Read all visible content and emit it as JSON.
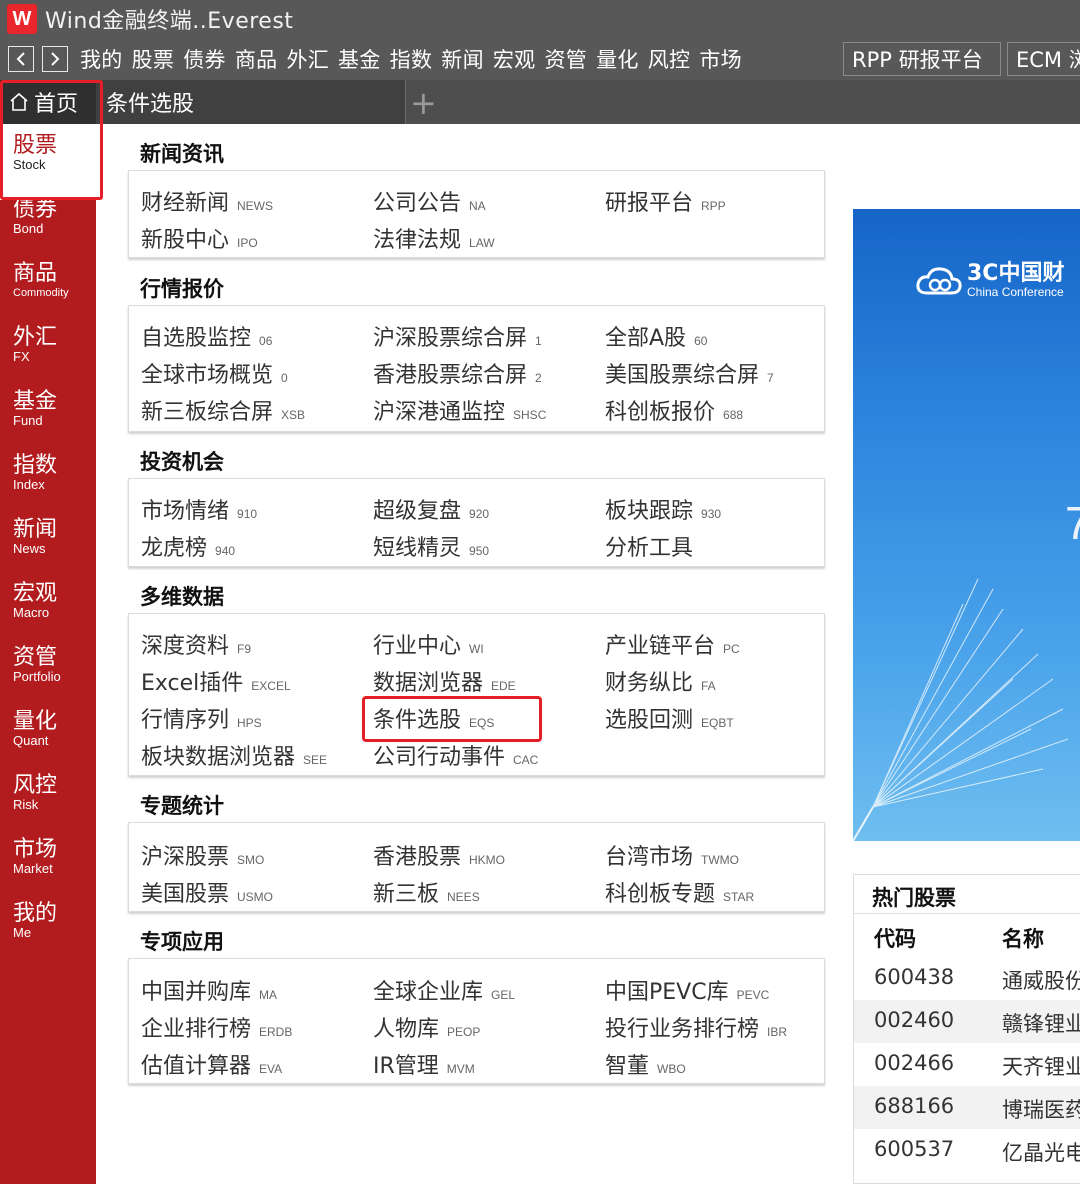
{
  "window": {
    "logo": "W",
    "title": "Wind金融终端..Everest"
  },
  "menubar": {
    "back_icon": "chevron-left-icon",
    "forward_icon": "chevron-right-icon",
    "items": [
      "我的",
      "股票",
      "债券",
      "商品",
      "外汇",
      "基金",
      "指数",
      "新闻",
      "宏观",
      "资管",
      "量化",
      "风控",
      "市场"
    ],
    "rpp_button": "RPP 研报平台",
    "ecm_button": "ECM 浏"
  },
  "tabs": {
    "home_icon": "home-icon",
    "home_label": "首页",
    "active_tab": "条件选股",
    "add_label": "+"
  },
  "sidebar": [
    {
      "zh": "股票",
      "en": "Stock"
    },
    {
      "zh": "债券",
      "en": "Bond"
    },
    {
      "zh": "商品",
      "en": "Commodity"
    },
    {
      "zh": "外汇",
      "en": "FX"
    },
    {
      "zh": "基金",
      "en": "Fund"
    },
    {
      "zh": "指数",
      "en": "Index"
    },
    {
      "zh": "新闻",
      "en": "News"
    },
    {
      "zh": "宏观",
      "en": "Macro"
    },
    {
      "zh": "资管",
      "en": "Portfolio"
    },
    {
      "zh": "量化",
      "en": "Quant"
    },
    {
      "zh": "风控",
      "en": "Risk"
    },
    {
      "zh": "市场",
      "en": "Market"
    },
    {
      "zh": "我的",
      "en": "Me"
    }
  ],
  "sections": [
    {
      "title": "新闻资讯",
      "items": [
        {
          "label": "财经新闻",
          "code": "NEWS"
        },
        {
          "label": "公司公告",
          "code": "NA"
        },
        {
          "label": "研报平台",
          "code": "RPP"
        },
        {
          "label": "新股中心",
          "code": "IPO"
        },
        {
          "label": "法律法规",
          "code": "LAW"
        }
      ]
    },
    {
      "title": "行情报价",
      "items": [
        {
          "label": "自选股监控",
          "code": "06"
        },
        {
          "label": "沪深股票综合屏",
          "code": "1"
        },
        {
          "label": "全部A股",
          "code": "60"
        },
        {
          "label": "全球市场概览",
          "code": "0"
        },
        {
          "label": "香港股票综合屏",
          "code": "2"
        },
        {
          "label": "美国股票综合屏",
          "code": "7"
        },
        {
          "label": "新三板综合屏",
          "code": "XSB"
        },
        {
          "label": "沪深港通监控",
          "code": "SHSC"
        },
        {
          "label": "科创板报价",
          "code": "688"
        }
      ]
    },
    {
      "title": "投资机会",
      "items": [
        {
          "label": "市场情绪",
          "code": "910"
        },
        {
          "label": "超级复盘",
          "code": "920"
        },
        {
          "label": "板块跟踪",
          "code": "930"
        },
        {
          "label": "龙虎榜",
          "code": "940"
        },
        {
          "label": "短线精灵",
          "code": "950"
        },
        {
          "label": "分析工具",
          "code": ""
        }
      ]
    },
    {
      "title": "多维数据",
      "items": [
        {
          "label": "深度资料",
          "code": "F9"
        },
        {
          "label": "行业中心",
          "code": "WI"
        },
        {
          "label": "产业链平台",
          "code": "PC"
        },
        {
          "label": "Excel插件",
          "code": "EXCEL"
        },
        {
          "label": "数据浏览器",
          "code": "EDE"
        },
        {
          "label": "财务纵比",
          "code": "FA"
        },
        {
          "label": "行情序列",
          "code": "HPS"
        },
        {
          "label": "条件选股",
          "code": "EQS"
        },
        {
          "label": "选股回测",
          "code": "EQBT"
        },
        {
          "label": "板块数据浏览器",
          "code": "SEE"
        },
        {
          "label": "公司行动事件",
          "code": "CAC"
        }
      ]
    },
    {
      "title": "专题统计",
      "items": [
        {
          "label": "沪深股票",
          "code": "SMO"
        },
        {
          "label": "香港股票",
          "code": "HKMO"
        },
        {
          "label": "台湾市场",
          "code": "TWMO"
        },
        {
          "label": "美国股票",
          "code": "USMO"
        },
        {
          "label": "新三板",
          "code": "NEES"
        },
        {
          "label": "科创板专题",
          "code": "STAR"
        }
      ]
    },
    {
      "title": "专项应用",
      "items": [
        {
          "label": "中国并购库",
          "code": "MA"
        },
        {
          "label": "全球企业库",
          "code": "GEL"
        },
        {
          "label": "中国PEVC库",
          "code": "PEVC"
        },
        {
          "label": "企业排行榜",
          "code": "ERDB"
        },
        {
          "label": "人物库",
          "code": "PEOP"
        },
        {
          "label": "投行业务排行榜",
          "code": "IBR"
        },
        {
          "label": "估值计算器",
          "code": "EVA"
        },
        {
          "label": "IR管理",
          "code": "MVM"
        },
        {
          "label": "智董",
          "code": "WBO"
        }
      ]
    }
  ],
  "banner": {
    "icon": "cloud-logo-icon",
    "title": "3C中国财",
    "subtitle": "China Conference"
  },
  "hot_stocks": {
    "title": "热门股票",
    "headers": [
      "代码",
      "名称"
    ],
    "rows": [
      {
        "code": "600438",
        "name": "通威股份"
      },
      {
        "code": "002460",
        "name": "赣锋锂业"
      },
      {
        "code": "002466",
        "name": "天齐锂业"
      },
      {
        "code": "688166",
        "name": "博瑞医药"
      },
      {
        "code": "600537",
        "name": "亿晶光电"
      }
    ]
  }
}
